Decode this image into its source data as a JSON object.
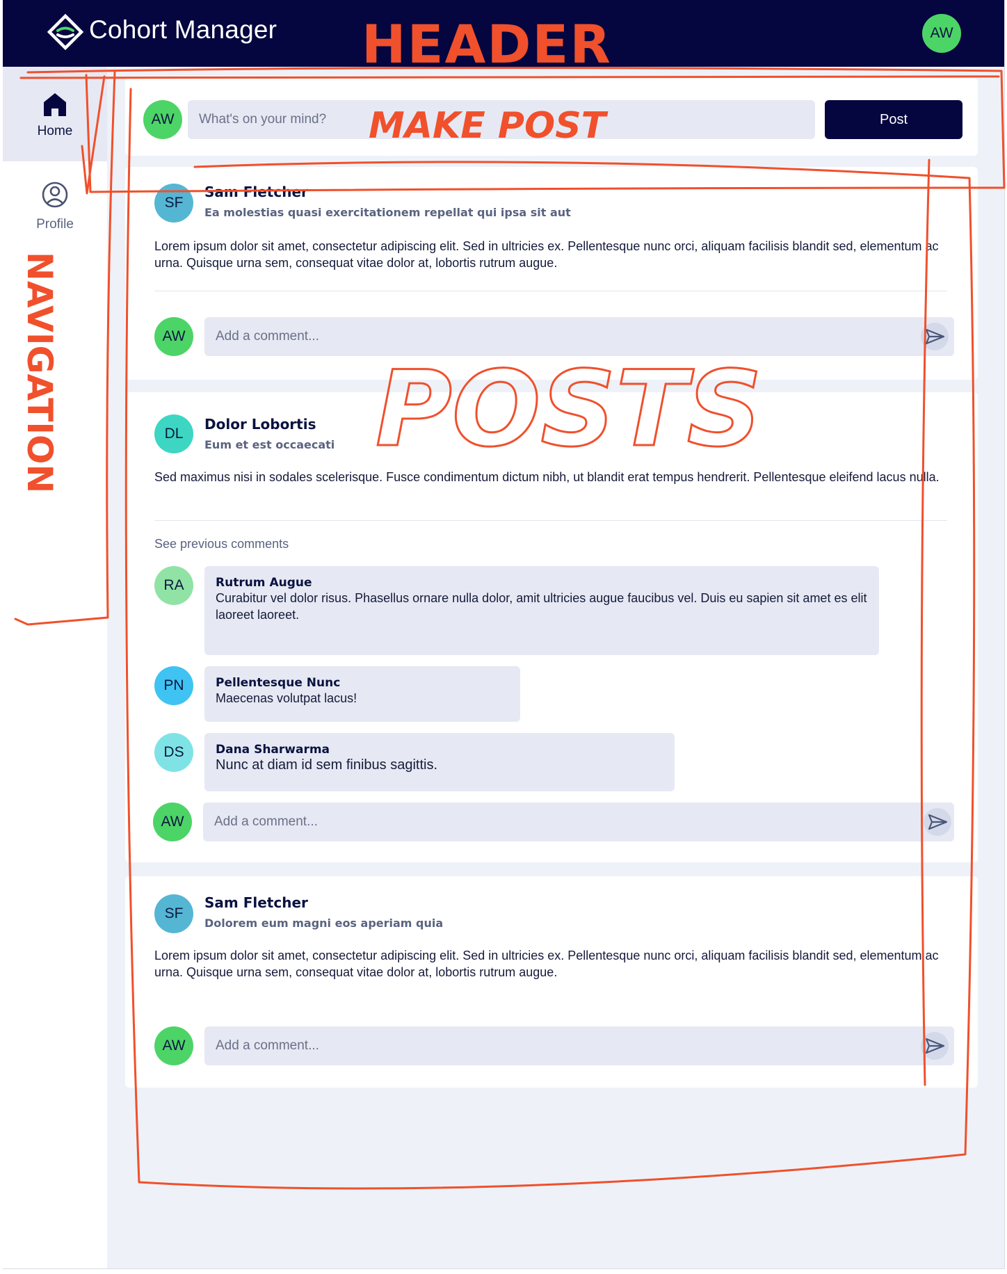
{
  "header": {
    "app_title": "Cohort Manager",
    "user_initials": "AW"
  },
  "sidebar": {
    "items": [
      {
        "label": "Home",
        "icon": "home-icon",
        "active": true
      },
      {
        "label": "Profile",
        "icon": "profile-icon",
        "active": false
      }
    ]
  },
  "composer": {
    "avatar_initials": "AW",
    "placeholder": "What's on your mind?",
    "button_label": "Post"
  },
  "posts": [
    {
      "author": "Sam Fletcher",
      "initials": "SF",
      "subtitle": "Ea molestias quasi exercitationem repellat qui ipsa sit aut",
      "body": "Lorem ipsum dolor sit amet, consectetur adipiscing elit. Sed in ultricies ex. Pellentesque nunc orci, aliquam facilisis blandit sed, elementum ac urna. Quisque urna sem, consequat vitae dolor at, lobortis rutrum augue.",
      "comment_avatar": "AW",
      "comment_placeholder": "Add a comment..."
    },
    {
      "author": "Dolor Lobortis",
      "initials": "DL",
      "subtitle": "Eum et est occaecati",
      "body": "Sed maximus nisi in sodales scelerisque. Fusce condimentum dictum nibh, ut blandit erat tempus hendrerit. Pellentesque eleifend lacus nulla.",
      "see_previous": "See previous comments",
      "comments": [
        {
          "initials": "RA",
          "author": "Rutrum Augue",
          "text": "Curabitur vel dolor risus. Phasellus ornare nulla dolor, amit ultricies augue faucibus vel. Duis eu sapien sit amet es elit laoreet laoreet."
        },
        {
          "initials": "PN",
          "author": "Pellentesque Nunc",
          "text": "Maecenas volutpat lacus!"
        },
        {
          "initials": "DS",
          "author": "Dana Sharwarma",
          "text": "Nunc at diam id sem finibus sagittis."
        }
      ],
      "comment_avatar": "AW",
      "comment_placeholder": "Add a comment..."
    },
    {
      "author": "Sam Fletcher",
      "initials": "SF",
      "subtitle": "Dolorem eum magni eos aperiam quia",
      "body": "Lorem ipsum dolor sit amet, consectetur adipiscing elit. Sed in ultricies ex. Pellentesque nunc orci, aliquam facilisis blandit sed, elementum ac urna. Quisque urna sem, consequat vitae dolor at, lobortis rutrum augue.",
      "comment_avatar": "AW",
      "comment_placeholder": "Add a comment..."
    }
  ],
  "annotations": {
    "header": "HEADER",
    "make_post": "MAKE POST",
    "navigation": "NAVIGATION",
    "posts": "POSTS",
    "color": "#f0502c"
  },
  "colors": {
    "header_bg": "#05053f",
    "accent_green": "#4dd467",
    "page_bg": "#eef2f8"
  }
}
